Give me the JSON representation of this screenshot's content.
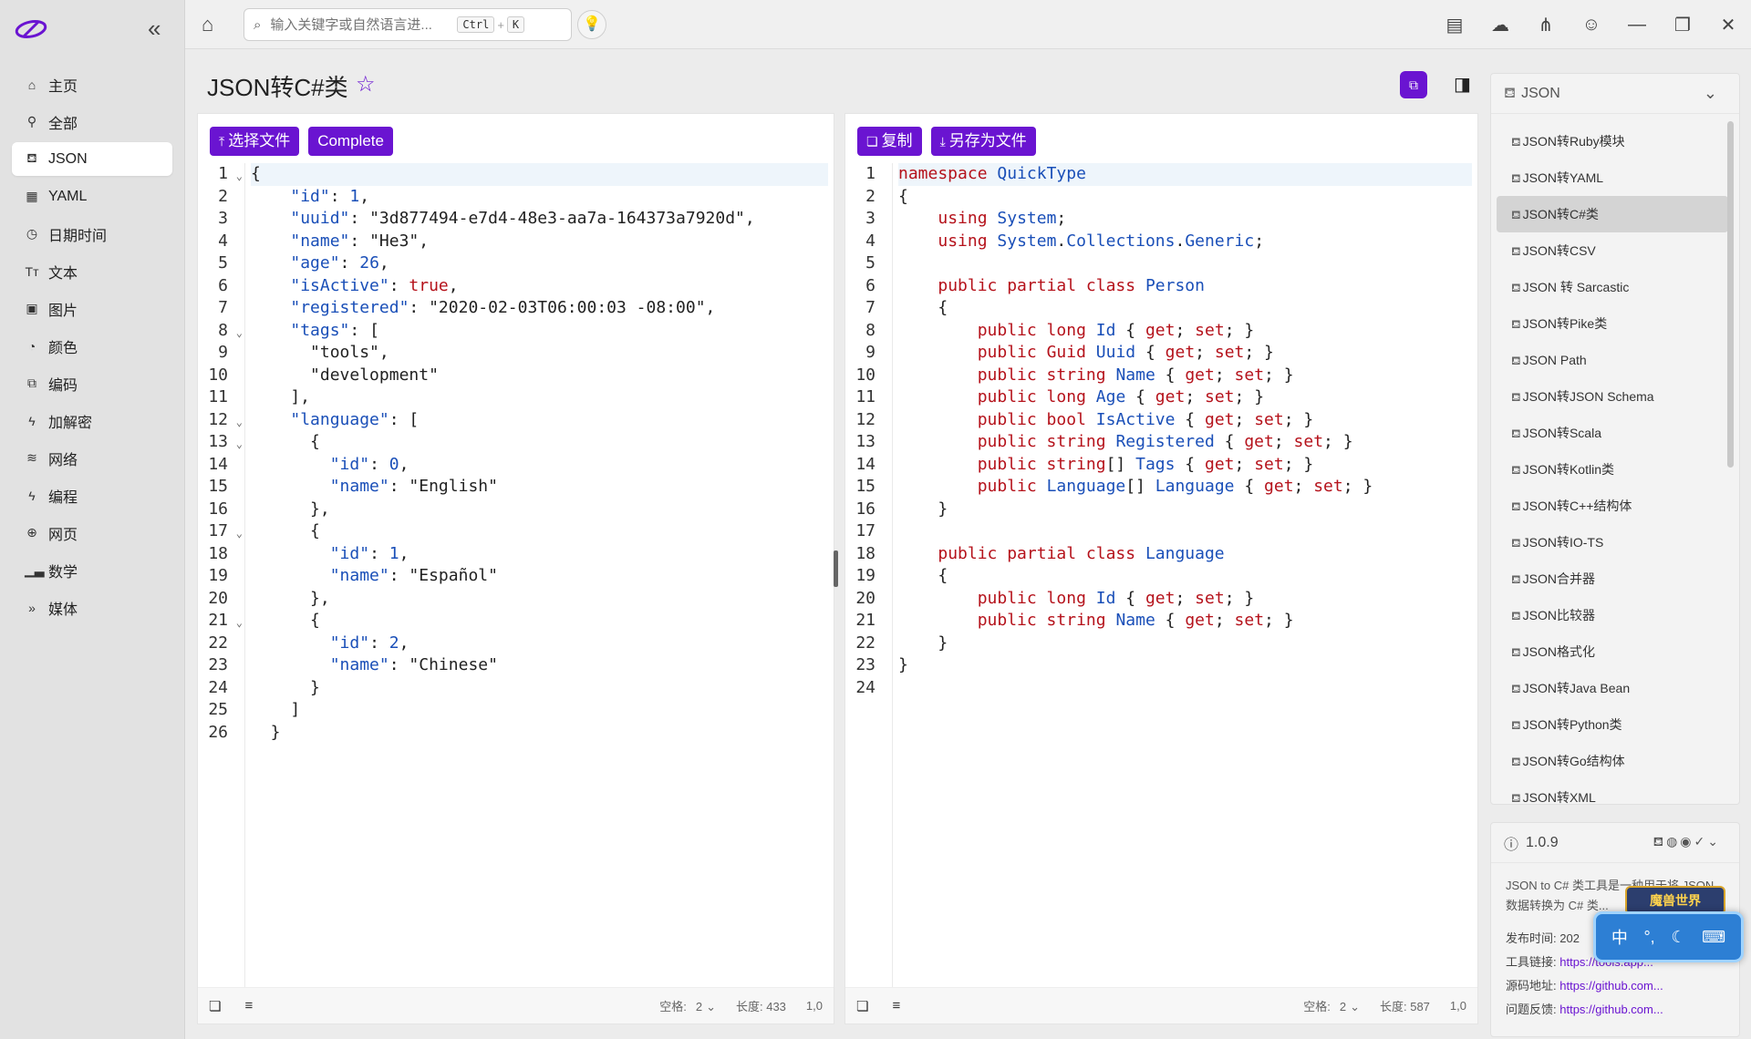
{
  "topbar": {
    "search_placeholder": "输入关键字或自然语言进...",
    "shortcut_ctrl": "Ctrl",
    "shortcut_plus": "+",
    "shortcut_key": "K"
  },
  "sidebar": {
    "items": [
      {
        "label": "主页",
        "icon": "home-icon"
      },
      {
        "label": "全部",
        "icon": "tag-icon"
      },
      {
        "label": "JSON",
        "icon": "json-icon",
        "active": true
      },
      {
        "label": "YAML",
        "icon": "grid-icon"
      },
      {
        "label": "日期时间",
        "icon": "clock-icon"
      },
      {
        "label": "文本",
        "icon": "text-icon"
      },
      {
        "label": "图片",
        "icon": "image-icon"
      },
      {
        "label": "颜色",
        "icon": "color-icon"
      },
      {
        "label": "编码",
        "icon": "encode-icon"
      },
      {
        "label": "加解密",
        "icon": "lightning-icon"
      },
      {
        "label": "网络",
        "icon": "wifi-icon"
      },
      {
        "label": "编程",
        "icon": "code-icon"
      },
      {
        "label": "网页",
        "icon": "globe-icon"
      },
      {
        "label": "数学",
        "icon": "chart-icon"
      },
      {
        "label": "媒体",
        "icon": "media-icon"
      }
    ]
  },
  "page": {
    "title": "JSON转C#类"
  },
  "left_pane": {
    "btn_select_file": "选择文件",
    "btn_complete": "Complete",
    "footer_space_label": "空格:",
    "footer_space_value": "2",
    "footer_length": "长度: 433",
    "footer_pos": "1,0"
  },
  "right_pane": {
    "btn_copy": "复制",
    "btn_save": "另存为文件",
    "footer_space_label": "空格:",
    "footer_space_value": "2",
    "footer_length": "长度: 587",
    "footer_pos": "1,0"
  },
  "right_panel": {
    "header": "JSON",
    "items": [
      "JSON转Ruby模块",
      "JSON转YAML",
      "JSON转C#类",
      "JSON转CSV",
      "JSON 转 Sarcastic",
      "JSON转Pike类",
      "JSON Path",
      "JSON转JSON Schema",
      "JSON转Scala",
      "JSON转Kotlin类",
      "JSON转C++结构体",
      "JSON转IO-TS",
      "JSON合并器",
      "JSON比较器",
      "JSON格式化",
      "JSON转Java Bean",
      "JSON转Python类",
      "JSON转Go结构体",
      "JSON转XML"
    ],
    "active_index": 2
  },
  "info_panel": {
    "version": "1.0.9",
    "desc": "JSON to C# 类工具是一种用于将 JSON 数据转换为 C# 类...",
    "publish_label": "发布时间:",
    "publish_value": "202",
    "toollink_label": "工具链接:",
    "toollink_value": "https://tools.app...",
    "source_label": "源码地址:",
    "source_value": "https://github.com...",
    "issue_label": "问题反馈:",
    "issue_value": "https://github.com..."
  },
  "ime": {
    "badge": "魔兽世界",
    "lang": "中"
  },
  "colors": {
    "accent": "#6a14d1",
    "keyword": "#b5121b",
    "type": "#1a4fb8"
  }
}
